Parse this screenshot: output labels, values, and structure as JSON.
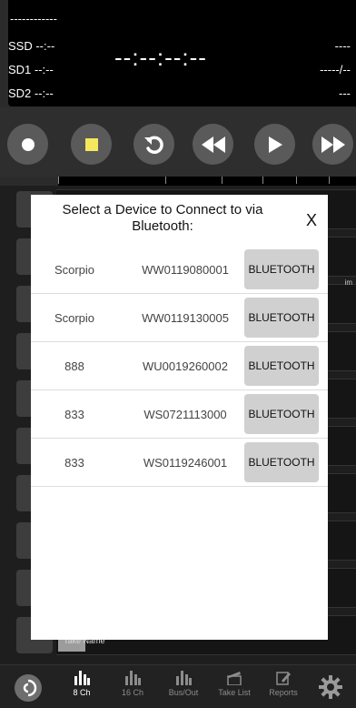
{
  "status_panel": {
    "top_line": "------------",
    "ssd_label": "SSD --:--",
    "sd1_label": "SD1 --:--",
    "sd2_label": "SD2 --:--",
    "timecode": "--:--:--:--",
    "right_top": "----",
    "right_mid": "-----/--",
    "right_bottom": "---"
  },
  "transport": {
    "buttons": [
      "record-button",
      "stop-button",
      "undo-button",
      "rewind-button",
      "play-button",
      "fast-forward-button"
    ],
    "colors": {
      "button_bg": "#5a5a5a",
      "stop": "#f5e85c",
      "record": "#ffffff"
    }
  },
  "tracks": {
    "side_label": "im",
    "bottom_track_label": "Take Name"
  },
  "modal": {
    "title": "Select a Device to Connect to via Bluetooth:",
    "close_label": "X",
    "devices": [
      {
        "name": "Scorpio",
        "serial": "WW0119080001",
        "button": "BLUETOOTH"
      },
      {
        "name": "Scorpio",
        "serial": "WW0119130005",
        "button": "BLUETOOTH"
      },
      {
        "name": "888",
        "serial": "WU0019260002",
        "button": "BLUETOOTH"
      },
      {
        "name": "833",
        "serial": "WS0721113000",
        "button": "BLUETOOTH"
      },
      {
        "name": "833",
        "serial": "WS0119246001",
        "button": "BLUETOOTH"
      }
    ]
  },
  "tabbar": {
    "tabs": [
      {
        "label": "8 Ch",
        "icon": "bars-icon",
        "active": true
      },
      {
        "label": "16 Ch",
        "icon": "bars-icon",
        "active": false
      },
      {
        "label": "Bus/Out",
        "icon": "bars-icon",
        "active": false
      },
      {
        "label": "Take List",
        "icon": "clapper-icon",
        "active": false
      },
      {
        "label": "Reports",
        "icon": "edit-icon",
        "active": false
      }
    ],
    "logo_icon": "sound-devices-logo-icon",
    "settings_icon": "gear-icon"
  }
}
